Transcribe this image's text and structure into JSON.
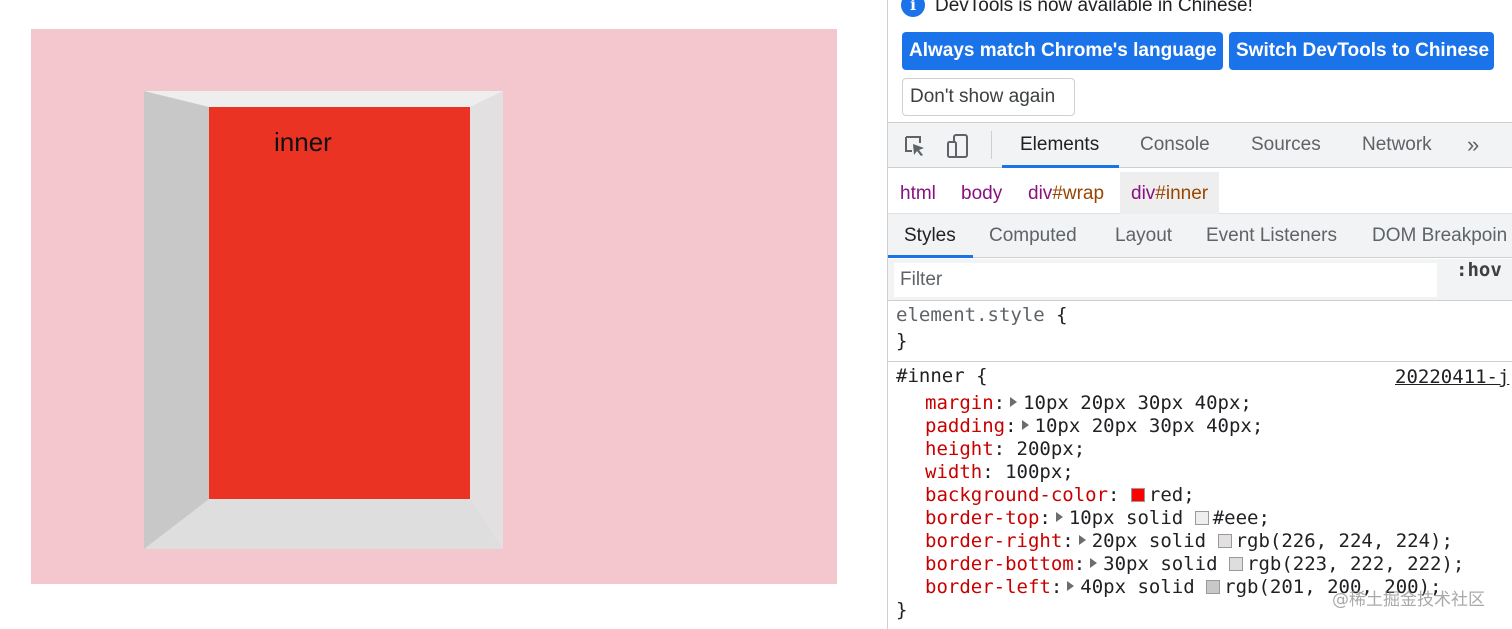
{
  "preview": {
    "inner_text": "inner",
    "colors": {
      "wrap_bg": "#f4c6cd",
      "inner_bg": "#ea3323",
      "border_top": "#eeeeee",
      "border_right": "#e2e0e0",
      "border_bottom": "#dfdede",
      "border_left": "#c9c8c8"
    }
  },
  "infobar": {
    "icon": "info-icon",
    "message": "DevTools is now available in Chinese!",
    "match_button": "Always match Chrome's language",
    "switch_button": "Switch DevTools to Chinese",
    "dont_show_button": "Don't show again"
  },
  "toolbar": {
    "icons": [
      "inspect-element-icon",
      "device-toolbar-icon"
    ],
    "tabs": [
      {
        "label": "Elements",
        "active": true
      },
      {
        "label": "Console",
        "active": false
      },
      {
        "label": "Sources",
        "active": false
      },
      {
        "label": "Network",
        "active": false
      }
    ],
    "more_tabs": "»"
  },
  "breadcrumbs": [
    {
      "tag": "html",
      "id": ""
    },
    {
      "tag": "body",
      "id": ""
    },
    {
      "tag": "div",
      "id": "#wrap"
    },
    {
      "tag": "div",
      "id": "#inner",
      "selected": true
    }
  ],
  "subtabs": [
    {
      "label": "Styles",
      "active": true
    },
    {
      "label": "Computed"
    },
    {
      "label": "Layout"
    },
    {
      "label": "Event Listeners"
    },
    {
      "label": "DOM Breakpoin"
    }
  ],
  "filter": {
    "placeholder": "Filter",
    "hov": ":hov"
  },
  "styles": {
    "element_style": {
      "selector": "element.style",
      "open": " {",
      "close": "}"
    },
    "inner_rule": {
      "selector": "#inner",
      "open": " {",
      "close": "}",
      "source": "20220411-j",
      "declarations": [
        {
          "prop": "margin",
          "expandable": true,
          "value": "10px 20px 30px 40px;"
        },
        {
          "prop": "padding",
          "expandable": true,
          "value": "10px 20px 30px 40px;"
        },
        {
          "prop": "height",
          "expandable": false,
          "value": "200px;"
        },
        {
          "prop": "width",
          "expandable": false,
          "value": "100px;"
        },
        {
          "prop": "background-color",
          "expandable": false,
          "swatch": "#ff0000",
          "value": "red;"
        },
        {
          "prop": "border-top",
          "expandable": true,
          "value_pre": "10px solid ",
          "swatch": "#eeeeee",
          "value": "#eee;"
        },
        {
          "prop": "border-right",
          "expandable": true,
          "value_pre": "20px solid ",
          "swatch": "#e2e0e0",
          "value": "rgb(226, 224, 224);"
        },
        {
          "prop": "border-bottom",
          "expandable": true,
          "value_pre": "30px solid ",
          "swatch": "#dfdede",
          "value": "rgb(223, 222, 222);"
        },
        {
          "prop": "border-left",
          "expandable": true,
          "value_pre": "40px solid ",
          "swatch": "#c9c8c8",
          "value": "rgb(201, 200, 200);"
        }
      ]
    }
  },
  "watermark": "@稀土掘金技术社区"
}
